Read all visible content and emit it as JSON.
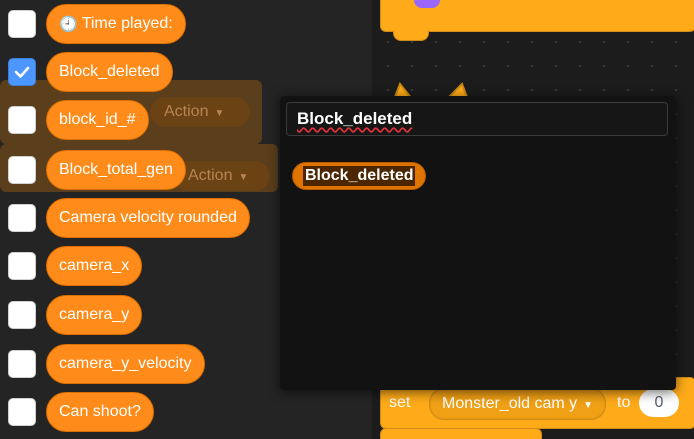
{
  "palette": {
    "variables": [
      {
        "label": "Time played:",
        "checked": false,
        "has_clock_icon": true
      },
      {
        "label": "Block_deleted",
        "checked": true
      },
      {
        "label": "block_id_#",
        "checked": false
      },
      {
        "label": "Block_total_gen",
        "checked": false
      },
      {
        "label": "Camera velocity rounded",
        "checked": false
      },
      {
        "label": "camera_x",
        "checked": false
      },
      {
        "label": "camera_y",
        "checked": false
      },
      {
        "label": "camera_y_velocity",
        "checked": false
      },
      {
        "label": "Can shoot?",
        "checked": false
      }
    ],
    "ghost_labels": {
      "action_1": "Action",
      "action_2": "Action"
    }
  },
  "search": {
    "value": "Block_deleted",
    "results": [
      "Block_deleted"
    ]
  },
  "workspace": {
    "set_block": {
      "label": "set",
      "variable": "Monster_old cam y",
      "to_label": "to",
      "value": "0"
    }
  },
  "colors": {
    "variable_block": "#ff8c1a",
    "checkbox_checked": "#4c97ff",
    "data_block": "#ffab19"
  }
}
